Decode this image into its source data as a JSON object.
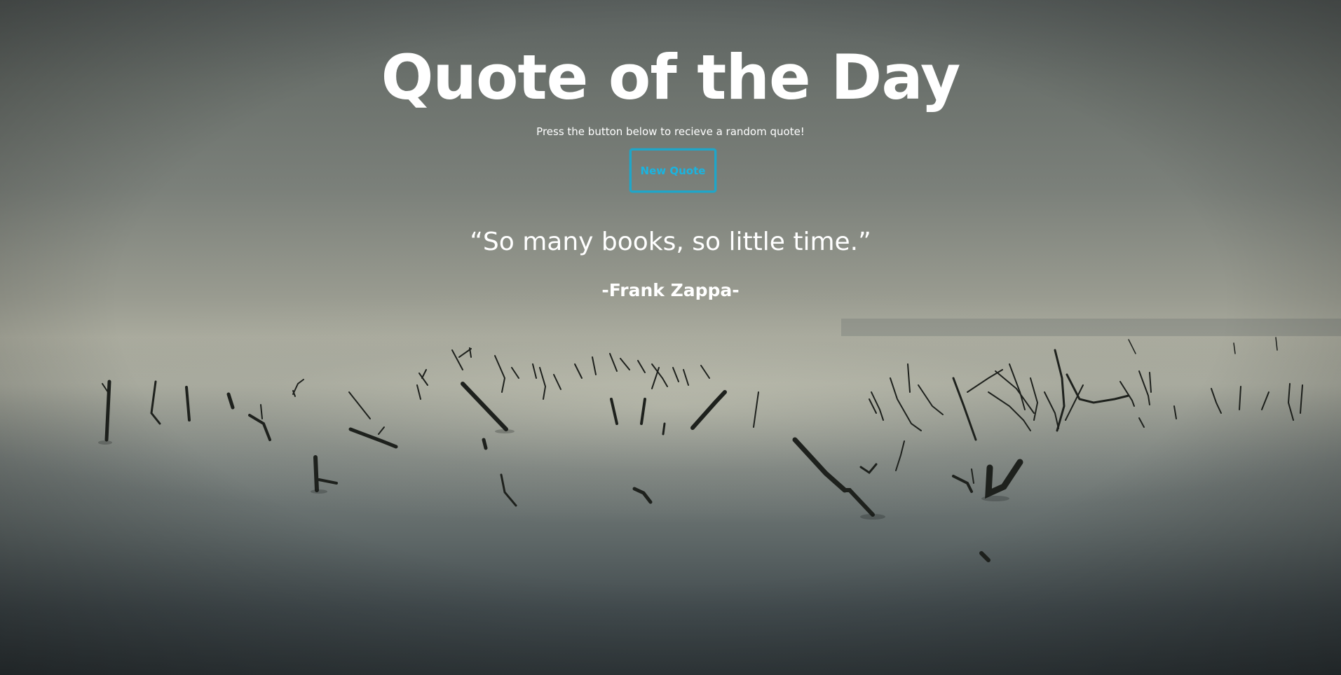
{
  "page": {
    "title": "Quote of the Day",
    "subtitle": "Press the button below to recieve a random quote!"
  },
  "button": {
    "label": "New Quote",
    "accent_color": "#1fa6c9"
  },
  "quote": {
    "text": "“So many books, so little time.”",
    "author": "-Frank Zappa-"
  },
  "background": {
    "description_icon": "misty-lake-branches-image"
  }
}
